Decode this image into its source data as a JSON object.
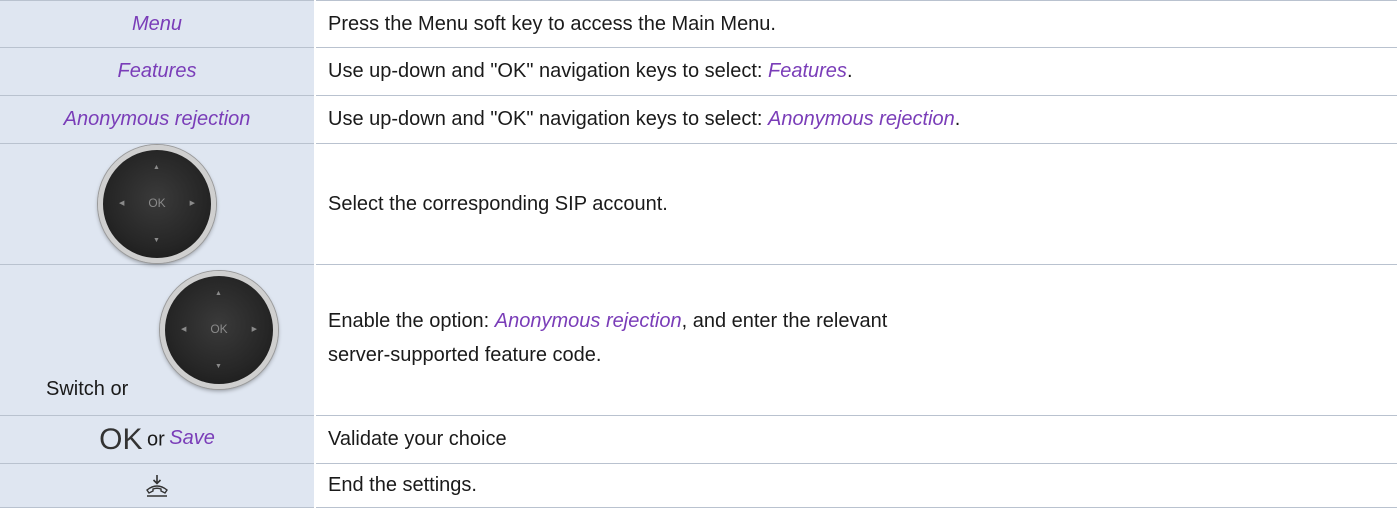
{
  "rows": [
    {
      "left": "Menu",
      "right": "Press the Menu soft key to access the Main Menu."
    },
    {
      "left": "Features",
      "right_prefix": "Use up-down and \"OK\" navigation keys to select: ",
      "right_em": "Features",
      "right_suffix": "."
    },
    {
      "left": "Anonymous rejection",
      "right_prefix": "Use up-down and \"OK\" navigation keys to select: ",
      "right_em": "Anonymous rejection",
      "right_suffix": "."
    },
    {
      "left_icon": "navigation-pad-icon",
      "pad_label": "OK",
      "right": "Select the corresponding SIP account."
    },
    {
      "left_text": "Switch or",
      "left_icon": "navigation-pad-icon",
      "pad_label": "OK",
      "right_prefix": "Enable the option: ",
      "right_em": "Anonymous rejection",
      "right_mid": ", and enter the relevant",
      "right_line2": "server-supported feature code."
    },
    {
      "left_ok": "OK",
      "left_or": "or",
      "left_save": "Save",
      "right": "Validate your choice"
    },
    {
      "left_icon": "hang-up-icon",
      "right": "End the settings."
    }
  ]
}
